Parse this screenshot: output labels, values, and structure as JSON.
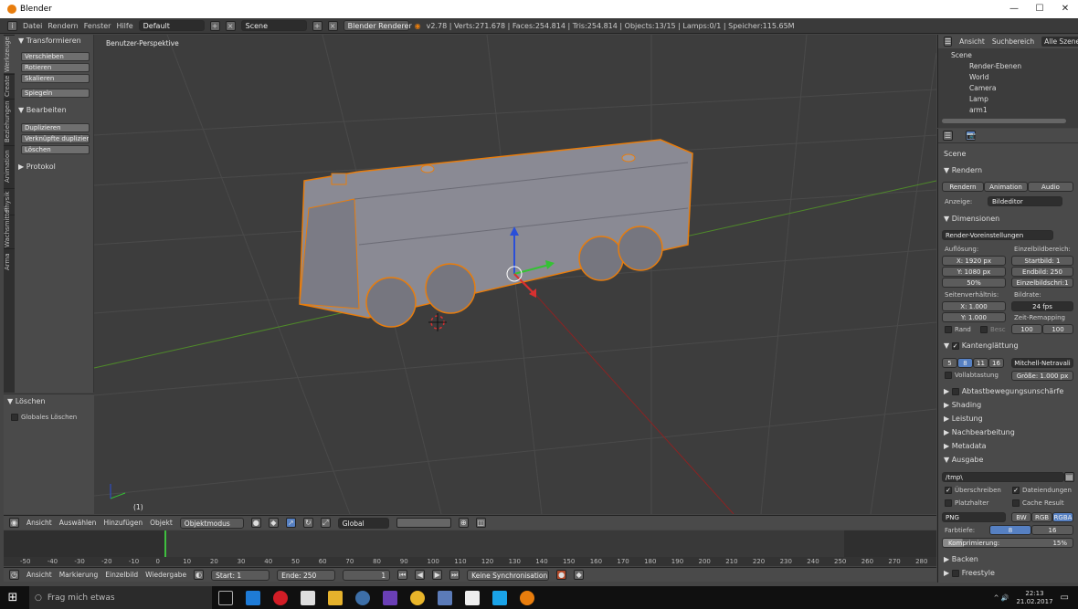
{
  "window": {
    "title": "Blender",
    "minimize": "—",
    "maximize": "☐",
    "close": "✕"
  },
  "infobar": {
    "menus": [
      "Datei",
      "Rendern",
      "Fenster",
      "Hilfe"
    ],
    "layout": "Default",
    "scene": "Scene",
    "engine": "Blender Renderer",
    "stats": "v2.78 | Verts:271.678 | Faces:254.814 | Tris:254.814 | Objects:13/15 | Lamps:0/1 | Speicher:115.65M"
  },
  "tabs": [
    "Werkzeuge",
    "Create",
    "Beziehungen",
    "Animation",
    "Physik",
    "Wachsmittel",
    "Arma"
  ],
  "toolshelf": {
    "transform_header": "▼ Transformieren",
    "transform_buttons": [
      "Verschieben",
      "Rotieren",
      "Skalieren"
    ],
    "mirror": "Spiegeln",
    "edit_header": "▼ Bearbeiten",
    "edit_buttons": [
      "Duplizieren",
      "Verknüpfte duplizieren",
      "Löschen"
    ],
    "history_header": "▶ Protokol"
  },
  "lastop": {
    "header": "▼ Löschen",
    "option": "Globales Löschen"
  },
  "viewport": {
    "label": "Benutzer-Perspektive",
    "frame": "(1)"
  },
  "view_header": {
    "menus": [
      "Ansicht",
      "Auswählen",
      "Hinzufügen",
      "Objekt"
    ],
    "mode": "Objektmodus",
    "orientation": "Global"
  },
  "timeline": {
    "ticks": [
      "-50",
      "-40",
      "-30",
      "-20",
      "-10",
      "0",
      "10",
      "20",
      "30",
      "40",
      "50",
      "60",
      "70",
      "80",
      "90",
      "100",
      "110",
      "120",
      "130",
      "140",
      "150",
      "160",
      "170",
      "180",
      "190",
      "200",
      "210",
      "220",
      "230",
      "240",
      "250",
      "260",
      "270",
      "280"
    ],
    "menus": [
      "Ansicht",
      "Markierung",
      "Einzelbild",
      "Wiedergabe"
    ],
    "start": "Start:",
    "start_val": "1",
    "end": "Ende:",
    "end_val": "250",
    "current": "1",
    "sync": "Keine Synchronisation"
  },
  "outliner": {
    "menus": [
      "Ansicht",
      "Suchbereich",
      "Alle Szenen"
    ],
    "items": [
      "Scene",
      "Render-Ebenen",
      "World",
      "Camera",
      "Lamp",
      "arm1"
    ]
  },
  "properties": {
    "breadcrumb": "Scene",
    "render_header": "▼ Rendern",
    "render_buttons": [
      "Rendern",
      "Animation",
      "Audio"
    ],
    "display_label": "Anzeige:",
    "display_val": "Bildeditor",
    "dim_header": "▼ Dimensionen",
    "presets": "Render-Voreinstellungen",
    "resolution_label": "Auflösung:",
    "res_x": "X:",
    "res_x_val": "1920 px",
    "res_y": "Y:",
    "res_y_val": "1080 px",
    "res_pct": "50%",
    "frame_range_label": "Einzelbildbereich:",
    "start": "Startbild:",
    "start_val": "1",
    "end": "Endbild:",
    "end_val": "250",
    "step": "Einzelbildschri:1",
    "aspect_label": "Seitenverhältnis:",
    "asp_x": "X:",
    "asp_x_val": "1.000",
    "asp_y": "Y:",
    "asp_y_val": "1.000",
    "fps_label": "Bildrate:",
    "fps": "24 fps",
    "remap_label": "Zeit-Remapping",
    "remap_old": "100",
    "remap_new": "100",
    "border": "Rand",
    "crop": "Besc",
    "aa_header": "Kantenglättung",
    "aa_samples": [
      "5",
      "8",
      "11",
      "16"
    ],
    "aa_filter": "Mitchell-Netravali",
    "full_sample": "Vollabtastung",
    "size": "Größe: 1.000 px",
    "collapsed": [
      "Abtastbewegungsunschärfe",
      "Shading",
      "Leistung",
      "Nachbearbeitung",
      "Metadata"
    ],
    "output_header": "▼ Ausgabe",
    "path": "/tmp\\",
    "overwrite": "Überschreiben",
    "extensions": "Dateiendungen",
    "placeholders": "Platzhalter",
    "cache": "Cache Result",
    "format": "PNG",
    "bw": "BW",
    "rgb": "RGB",
    "rgba": "RGBA",
    "depth_label": "Farbtiefe:",
    "depth8": "8",
    "depth16": "16",
    "compression": "Komprimierung:",
    "compression_val": "15%",
    "bake": "Backen",
    "freestyle": "Freestyle"
  },
  "taskbar": {
    "search": "Frag mich etwas",
    "time": "22:13",
    "date": "21.02.2017",
    "tray": "^ 🔊"
  },
  "colors": {
    "selection": "#e87d0d",
    "accent": "#5680c2",
    "grid_x": "#8b2323",
    "grid_y": "#4f8a2a"
  }
}
